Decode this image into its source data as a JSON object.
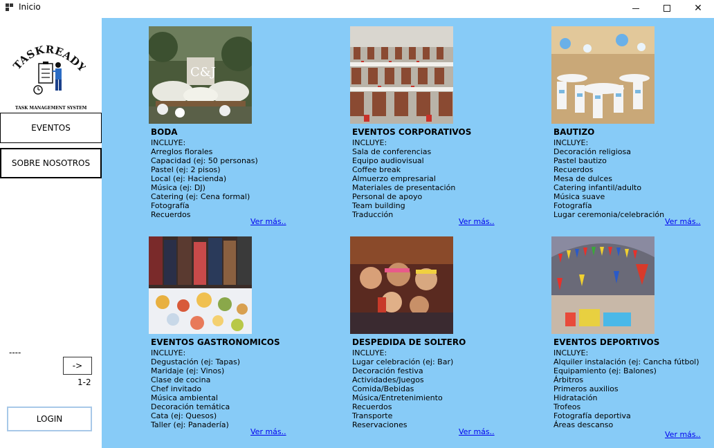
{
  "window": {
    "title": "Inicio"
  },
  "sidebar": {
    "logo_text": "TASKREADY",
    "logo_subtitle": "TASK MANAGEMENT SYSTEM",
    "nav": [
      {
        "label": "EVENTOS"
      },
      {
        "label": "SOBRE NOSOTROS"
      }
    ],
    "dashes": "----",
    "next_button": "->",
    "page_indicator": "1-2",
    "login_button": "LOGIN"
  },
  "cards": [
    {
      "title": "BODA",
      "includes_label": "INCLUYE:",
      "items": [
        "Arreglos florales",
        "Capacidad (ej: 50 personas)",
        "Pastel (ej: 2 pisos)",
        "Local (ej: Hacienda)",
        "Música (ej: DJ)",
        "Catering (ej: Cena formal)",
        "Fotografía",
        "Recuerdos"
      ],
      "link": "Ver más..",
      "image_label": "C&J"
    },
    {
      "title": "EVENTOS CORPORATIVOS",
      "includes_label": "INCLUYE:",
      "items": [
        "Sala de conferencias",
        "Equipo audiovisual",
        "Coffee break",
        "Almuerzo empresarial",
        "Materiales de presentación",
        "Personal de apoyo",
        "Team building",
        "Traducción"
      ],
      "link": "Ver más.."
    },
    {
      "title": "BAUTIZO",
      "includes_label": "INCLUYE:",
      "items": [
        "Decoración religiosa",
        "Pastel bautizo",
        "Recuerdos",
        "Mesa de dulces",
        "Catering infantil/adulto",
        "Música suave",
        "Fotografía",
        "Lugar ceremonia/celebración"
      ],
      "link": "Ver más.."
    },
    {
      "title": "EVENTOS GASTRONOMICOS",
      "includes_label": "INCLUYE:",
      "items": [
        "Degustación (ej: Tapas)",
        "Maridaje (ej: Vinos)",
        "Clase de cocina",
        "Chef invitado",
        "Música ambiental",
        "Decoración temática",
        "Cata (ej: Quesos)",
        "Taller (ej: Panadería)"
      ],
      "link": "Ver más.."
    },
    {
      "title": "DESPEDIDA DE SOLTERO",
      "includes_label": "INCLUYE:",
      "items": [
        "Lugar celebración (ej: Bar)",
        "Decoración festiva",
        "Actividades/Juegos",
        "Comida/Bebidas",
        "Música/Entretenimiento",
        "Recuerdos",
        "Transporte",
        "Reservaciones"
      ],
      "link": "Ver más.."
    },
    {
      "title": "EVENTOS DEPORTIVOS",
      "includes_label": "INCLUYE:",
      "items": [
        "Alquiler instalación (ej: Cancha fútbol)",
        "Equipamiento (ej: Balones)",
        "Árbitros",
        "Primeros auxilios",
        "Hidratación",
        "Trofeos",
        "Fotografía deportiva",
        "Áreas descanso"
      ],
      "link": "Ver más.."
    }
  ],
  "colors": {
    "main_bg": "#87cbf7",
    "link": "#0000ee"
  }
}
